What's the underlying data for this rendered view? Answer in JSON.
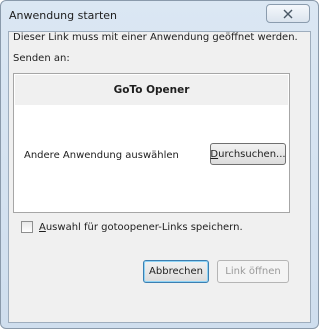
{
  "window": {
    "title": "Anwendung starten",
    "close_symbol": "✕"
  },
  "dialog": {
    "message": "Dieser Link muss mit einer Anwendung geöffnet werden.",
    "send_to_label": "Senden an:",
    "applications": [
      {
        "name": "GoTo Opener"
      }
    ],
    "other_app_label": "Andere Anwendung auswählen",
    "browse_button": {
      "accesskey": "D",
      "rest": "urchsuchen..."
    },
    "remember_checkbox": {
      "checked": false,
      "accesskey": "A",
      "rest": "uswahl für gotoopener-Links speichern."
    },
    "cancel_button": "Abbrechen",
    "open_button": "Link öffnen",
    "open_button_enabled": false
  },
  "colors": {
    "title_bar": "#d6e4f1",
    "client_bg": "#f0f0f0",
    "default_button_border": "#3c7fb1",
    "disabled_text": "#9a9a9a"
  }
}
